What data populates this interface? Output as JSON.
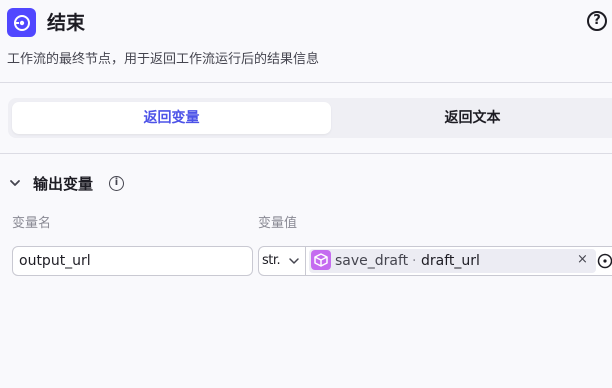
{
  "header": {
    "title": "结束",
    "description": "工作流的最终节点，用于返回工作流运行后的结果信息",
    "help_icon_glyph": "?"
  },
  "tabs": [
    {
      "label": "返回变量",
      "active": true
    },
    {
      "label": "返回文本",
      "active": false
    }
  ],
  "output_section": {
    "title": "输出变量",
    "info_glyph": "i",
    "columns": {
      "name": "变量名",
      "value": "变量值"
    },
    "rows": [
      {
        "name": "output_url",
        "type": "str.",
        "ref_node": "save_draft",
        "ref_sep": "·",
        "ref_field": "draft_url",
        "clear_glyph": "×"
      }
    ]
  },
  "colors": {
    "accent": "#4d53e8",
    "node_icon": "#5147ff",
    "ref_icon": "#c56cf0"
  }
}
